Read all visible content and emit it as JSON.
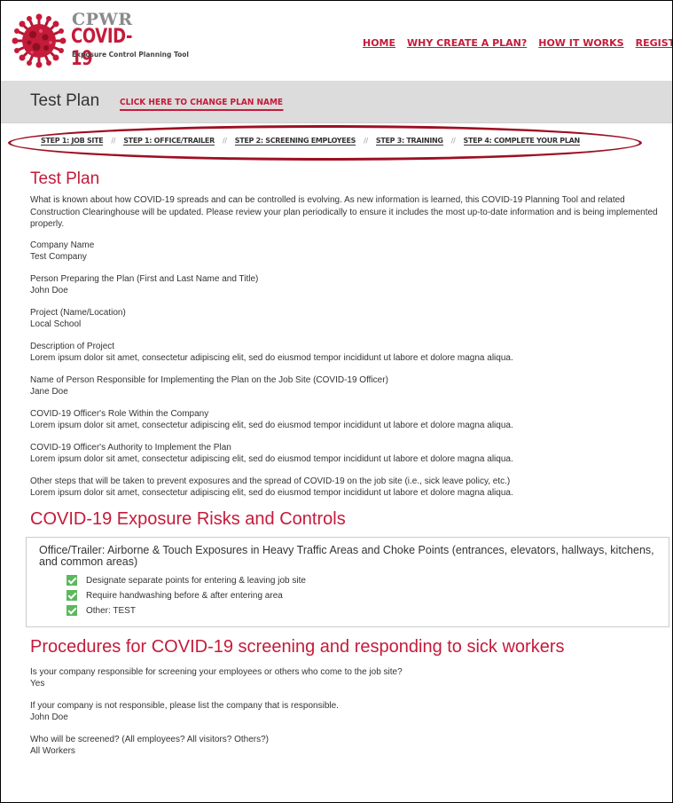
{
  "header": {
    "logo": {
      "org": "CPWR",
      "product": "COVID-19",
      "tagline": "Exposure Control Planning Tool"
    },
    "nav": [
      "HOME",
      "WHY CREATE A PLAN?",
      "HOW IT WORKS",
      "REGISTER/"
    ]
  },
  "plan_bar": {
    "name": "Test Plan",
    "change_link": "CLICK HERE TO CHANGE PLAN NAME"
  },
  "steps": {
    "separator": "//",
    "items": [
      "STEP 1: JOB SITE",
      "STEP 1: OFFICE/TRAILER",
      "STEP 2: SCREENING EMPLOYEES",
      "STEP 3: TRAINING",
      "STEP 4: COMPLETE YOUR PLAN"
    ]
  },
  "plan": {
    "title": "Test Plan",
    "intro": "What is known about how COVID-19 spreads and can be controlled is evolving. As new information is learned, this COVID-19 Planning Tool and related Construction Clearinghouse will be updated. Please review your plan periodically to ensure it includes the most up-to-date information and is being implemented properly.",
    "fields": [
      {
        "label": "Company Name",
        "value": "Test Company"
      },
      {
        "label": "Person Preparing the Plan (First and Last Name and Title)",
        "value": "John Doe"
      },
      {
        "label": "Project (Name/Location)",
        "value": "Local School"
      },
      {
        "label": "Description of Project",
        "value": "Lorem ipsum dolor sit amet, consectetur adipiscing elit, sed do eiusmod tempor incididunt ut labore et dolore magna aliqua."
      },
      {
        "label": "Name of Person Responsible for Implementing the Plan on the Job Site (COVID-19 Officer)",
        "value": "Jane Doe"
      },
      {
        "label": "COVID-19 Officer's Role Within the Company",
        "value": "Lorem ipsum dolor sit amet, consectetur adipiscing elit, sed do eiusmod tempor incididunt ut labore et dolore magna aliqua."
      },
      {
        "label": "COVID-19 Officer's Authority to Implement the Plan",
        "value": "Lorem ipsum dolor sit amet, consectetur adipiscing elit, sed do eiusmod tempor incididunt ut labore et dolore magna aliqua."
      },
      {
        "label": "Other steps that will be taken to prevent exposures and the spread of COVID-19 on the job site (i.e., sick leave policy, etc.)",
        "value": "Lorem ipsum dolor sit amet, consectetur adipiscing elit, sed do eiusmod tempor incididunt ut labore et dolore magna aliqua."
      }
    ]
  },
  "risks": {
    "title": "COVID-19 Exposure Risks and Controls",
    "box_title": "Office/Trailer: Airborne & Touch Exposures in Heavy Traffic Areas and Choke Points (entrances, elevators, hallways, kitchens, and common areas)",
    "controls": [
      "Designate separate points for entering & leaving job site",
      "Require handwashing before & after entering area",
      "Other: TEST"
    ]
  },
  "procedures": {
    "title": "Procedures for COVID-19 screening and responding to sick workers",
    "fields": [
      {
        "label": "Is your company responsible for screening your employees or others who come to the job site?",
        "value": "Yes"
      },
      {
        "label": "If your company is not responsible, please list the company that is responsible.",
        "value": "John Doe"
      },
      {
        "label": "Who will be screened? (All employees? All visitors? Others?)",
        "value": "All Workers"
      }
    ]
  },
  "colors": {
    "brand_red": "#c41b3a",
    "highlight_ellipse": "#9e0f22",
    "check_green": "#5cb85c",
    "plan_bar_bg": "#dcdcdc"
  },
  "icons": {
    "logo": "virus-icon",
    "checkbox": "checkbox-checked-icon"
  }
}
